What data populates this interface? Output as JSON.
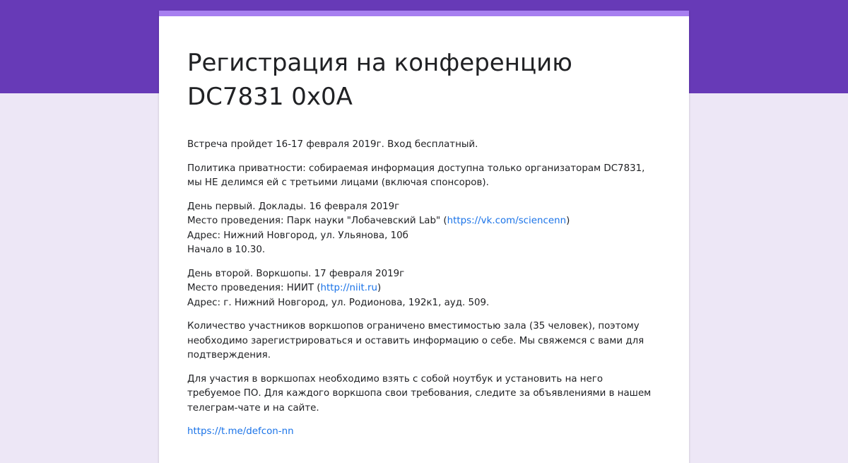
{
  "colors": {
    "header_band": "#673ab7",
    "page_background": "#ede7f6",
    "card_accent": "#a77ff0",
    "link": "#1a73e8"
  },
  "form": {
    "title_line1": "Регистрация на конференцию",
    "title_line2": "DC7831 0x0A",
    "intro": "Встреча пройдет 16-17 февраля 2019г. Вход бесплатный.",
    "privacy_line1": "Политика приватности: собираемая информация доступна только организаторам DC7831,",
    "privacy_line2": "мы НЕ делимся ей с третьими лицами (включая спонсоров).",
    "day1": {
      "heading": "День первый. Доклады. 16 февраля 2019г",
      "venue_prefix": "Место проведения: Парк науки \"Лобачевский Lab\" (",
      "venue_link": "https://vk.com/sciencenn",
      "venue_suffix": ")",
      "address": "Адрес: Нижний Новгород, ул. Ульянова, 10б",
      "start": "Начало в 10.30."
    },
    "day2": {
      "heading": "День второй. Воркшопы. 17 февраля 2019г",
      "venue_prefix": "Место проведения: НИИТ (",
      "venue_link": "http://niit.ru",
      "venue_suffix": ")",
      "address": "Адрес: г. Нижний Новгород, ул. Родионова, 192к1, ауд. 509."
    },
    "capacity_line1": "Количество участников воркшопов ограничено вместимостью зала (35 человек), поэтому",
    "capacity_line2": "необходимо зарегистрироваться и оставить информацию о себе. Мы свяжемся с вами для",
    "capacity_line3": "подтверждения.",
    "laptop_line1": "Для участия в воркшопах необходимо взять с собой ноутбук и установить на него",
    "laptop_line2": "требуемое ПО. Для каждого воркшопа свои требования, следите за объявлениями в нашем",
    "laptop_line3": "телеграм-чате и на сайте.",
    "telegram_link": "https://t.me/defcon-nn"
  }
}
